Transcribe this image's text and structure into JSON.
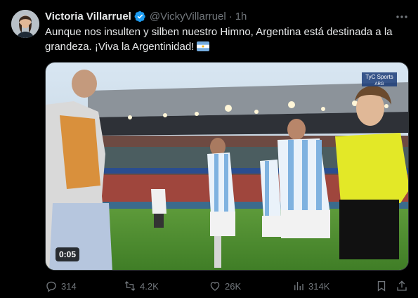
{
  "post": {
    "author_name": "Victoria Villarruel",
    "handle": "@VickyVillarruel",
    "separator": "·",
    "time": "1h",
    "text": "Aunque nos insulten y silben nuestro Himno, Argentina está destinada a la grandeza. ¡Viva la Argentinidad!",
    "verified": true
  },
  "media": {
    "video_time": "0:05",
    "broadcaster_logo": "TyC Sports",
    "broadcaster_sub": "ARG"
  },
  "actions": {
    "replies": "314",
    "reposts": "4.2K",
    "likes": "26K",
    "views": "314K"
  },
  "colors": {
    "background": "#000000",
    "text_primary": "#e7e9ea",
    "text_secondary": "#71767b",
    "verified_blue": "#1d9bf0"
  },
  "icons": [
    "verified-badge-icon",
    "more-icon",
    "argentina-flag-icon",
    "reply-icon",
    "repost-icon",
    "like-icon",
    "views-icon",
    "bookmark-icon",
    "share-icon"
  ]
}
